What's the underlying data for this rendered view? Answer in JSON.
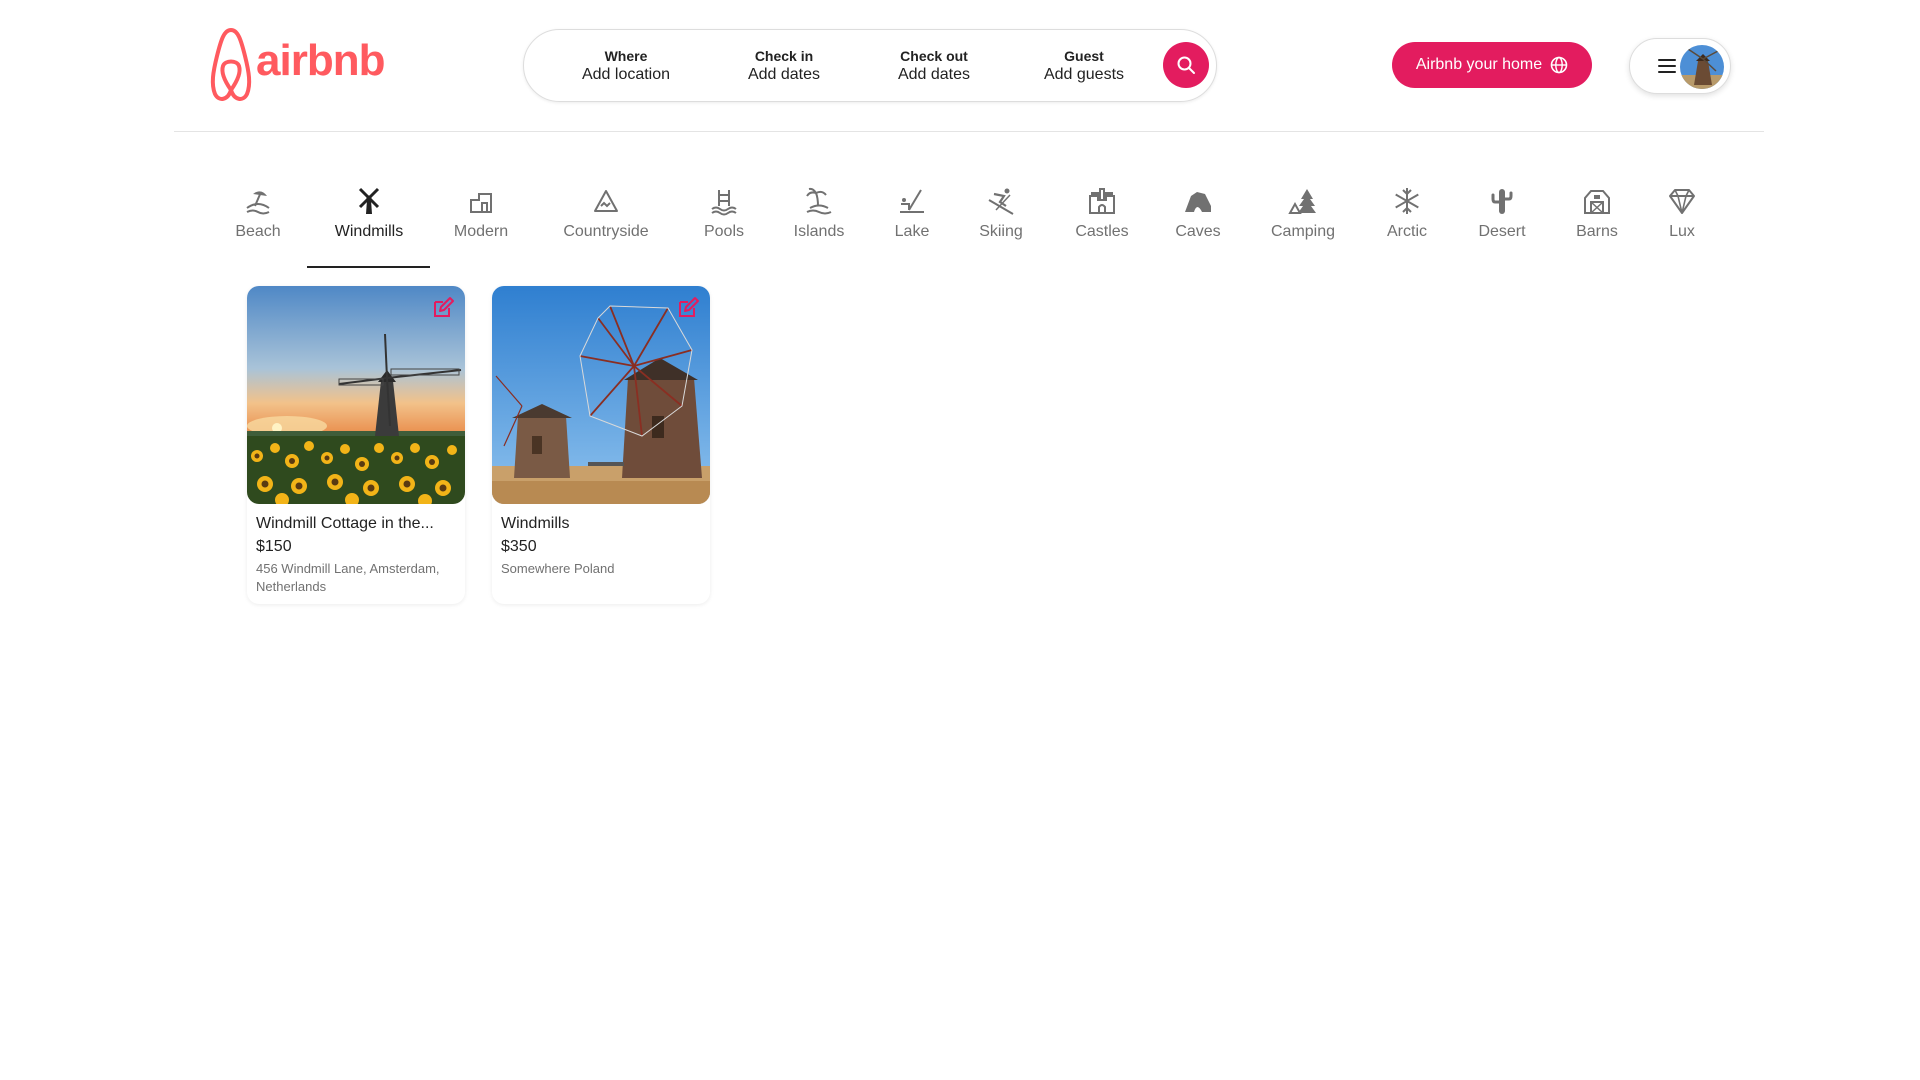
{
  "header": {
    "logo_text": "airbnb",
    "brand_color": "#ff5a5f",
    "accent_color": "#e31c5f"
  },
  "search": {
    "where_label": "Where",
    "where_value": "Add location",
    "checkin_label": "Check in",
    "checkin_value": "Add dates",
    "checkout_label": "Check out",
    "checkout_value": "Add dates",
    "guest_label": "Guest",
    "guest_value": "Add guests",
    "search_icon": "search-icon"
  },
  "host": {
    "label": "Airbnb your home",
    "icon": "globe-icon"
  },
  "profile": {
    "menu_icon": "hamburger-icon"
  },
  "categories": {
    "active": "Windmills",
    "items": [
      {
        "label": "Beach",
        "icon": "beach-icon"
      },
      {
        "label": "Windmills",
        "icon": "windmill-icon"
      },
      {
        "label": "Modern",
        "icon": "modern-house-icon"
      },
      {
        "label": "Countryside",
        "icon": "mountain-icon"
      },
      {
        "label": "Pools",
        "icon": "pool-icon"
      },
      {
        "label": "Islands",
        "icon": "island-icon"
      },
      {
        "label": "Lake",
        "icon": "lake-icon"
      },
      {
        "label": "Skiing",
        "icon": "skiing-icon"
      },
      {
        "label": "Castles",
        "icon": "castle-icon"
      },
      {
        "label": "Caves",
        "icon": "cave-icon"
      },
      {
        "label": "Camping",
        "icon": "camping-icon"
      },
      {
        "label": "Arctic",
        "icon": "snowflake-icon"
      },
      {
        "label": "Desert",
        "icon": "cactus-icon"
      },
      {
        "label": "Barns",
        "icon": "barn-icon"
      },
      {
        "label": "Lux",
        "icon": "diamond-icon"
      }
    ]
  },
  "listings": [
    {
      "title": "Windmill Cottage in the...",
      "price": "$150",
      "address": "456 Windmill Lane, Amsterdam, Netherlands",
      "image": "sunflower-field-windmill-photo"
    },
    {
      "title": "Windmills",
      "price": "$350",
      "address": "Somewhere Poland",
      "image": "stone-windmills-photo"
    }
  ]
}
